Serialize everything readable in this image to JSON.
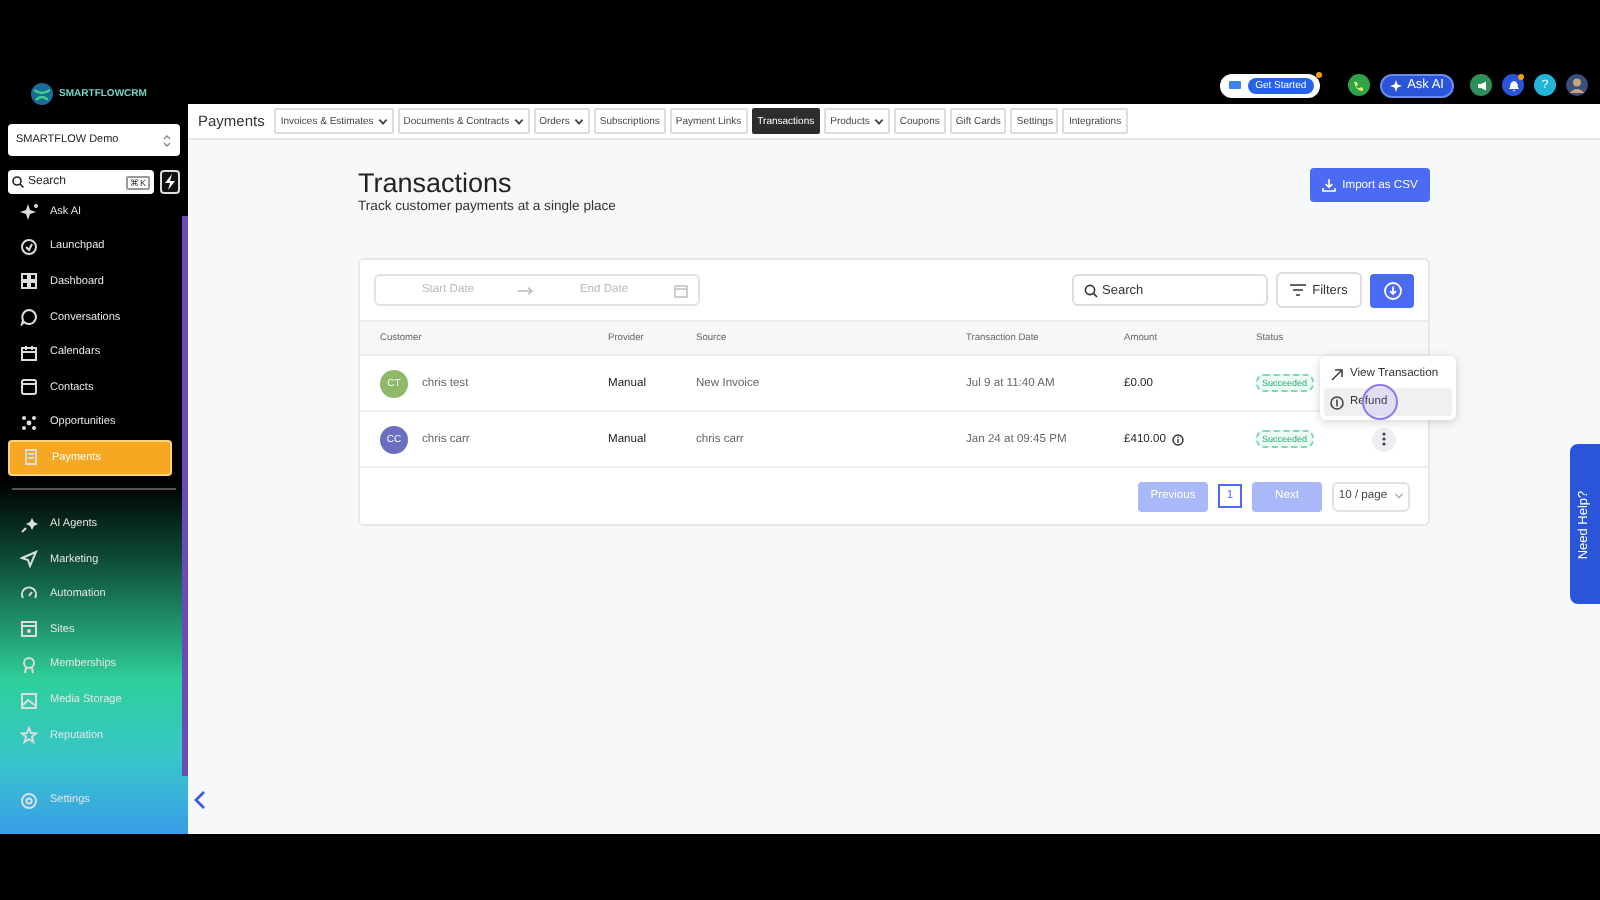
{
  "sidebar": {
    "logo": "SMARTFLOWCRM",
    "account": "SMARTFLOW Demo",
    "search": {
      "placeholder": "Search",
      "shortcut": "⌘K"
    },
    "items": [
      {
        "label": "Ask AI",
        "selected": false
      },
      {
        "label": "Launchpad",
        "selected": false
      },
      {
        "label": "Dashboard",
        "selected": false
      },
      {
        "label": "Conversations",
        "selected": false
      },
      {
        "label": "Calendars",
        "selected": false
      },
      {
        "label": "Contacts",
        "selected": false
      },
      {
        "label": "Opportunities",
        "selected": false
      },
      {
        "label": "Payments",
        "selected": true
      }
    ],
    "items_2": [
      {
        "label": "AI Agents",
        "selected": false
      },
      {
        "label": "Marketing",
        "selected": false
      },
      {
        "label": "Automation",
        "selected": false
      },
      {
        "label": "Sites",
        "selected": false
      },
      {
        "label": "Memberships",
        "selected": false
      },
      {
        "label": "Media Storage",
        "selected": false
      },
      {
        "label": "Reputation",
        "selected": false
      }
    ],
    "settings": {
      "label": "Settings",
      "selected": false
    }
  },
  "header": {
    "get_started": "Get Started",
    "ask_ai": "Ask AI",
    "help": "?"
  },
  "nav": {
    "title": "Payments",
    "tabs": [
      {
        "label": "Invoices & Estimates",
        "dropdown": true,
        "selected": false
      },
      {
        "label": "Documents & Contracts",
        "dropdown": true,
        "selected": false
      },
      {
        "label": "Orders",
        "dropdown": true,
        "selected": false
      },
      {
        "label": "Subscriptions",
        "dropdown": false,
        "selected": false
      },
      {
        "label": "Payment Links",
        "dropdown": false,
        "selected": false
      },
      {
        "label": "Transactions",
        "dropdown": false,
        "selected": true
      },
      {
        "label": "Products",
        "dropdown": true,
        "selected": false
      },
      {
        "label": "Coupons",
        "dropdown": false,
        "selected": false
      },
      {
        "label": "Gift Cards",
        "dropdown": false,
        "selected": false
      },
      {
        "label": "Settings",
        "dropdown": false,
        "selected": false
      },
      {
        "label": "Integrations",
        "dropdown": false,
        "selected": false
      }
    ]
  },
  "page": {
    "title": "Transactions",
    "subtitle": "Track customer payments at a single place",
    "import_button": "Import as CSV"
  },
  "filters": {
    "start_date": {
      "placeholder": "Start Date"
    },
    "end_date": {
      "placeholder": "End Date"
    },
    "search": {
      "placeholder": "Search"
    },
    "filters_button": "Filters"
  },
  "table": {
    "columns": [
      "Customer",
      "Provider",
      "Source",
      "Transaction Date",
      "Amount",
      "Status"
    ],
    "rows": [
      {
        "initials": "CT",
        "color": "#8fb86a",
        "customer": "chris test",
        "provider": "Manual",
        "source": "New Invoice",
        "date": "Jul 9 at 11:40 AM",
        "amount": "£0.00",
        "amount_info": false,
        "status": "Succeeded"
      },
      {
        "initials": "CC",
        "color": "#6b6fc0",
        "customer": "chris carr",
        "provider": "Manual",
        "source": "chris carr",
        "date": "Jan 24 at 09:45 PM",
        "amount": "£410.00",
        "amount_info": true,
        "status": "Succeeded",
        "actions_button": true
      }
    ]
  },
  "pagination": {
    "previous": {
      "label": "Previous",
      "disabled": true
    },
    "pages": [
      {
        "label": "1",
        "selected": true
      }
    ],
    "next": {
      "label": "Next",
      "disabled": true
    },
    "page_size": "10 / page"
  },
  "menu": {
    "items": [
      {
        "label": "View Transaction",
        "selected": false
      },
      {
        "label": "Refund",
        "selected": true
      }
    ]
  },
  "need_help": "Need Help?"
}
